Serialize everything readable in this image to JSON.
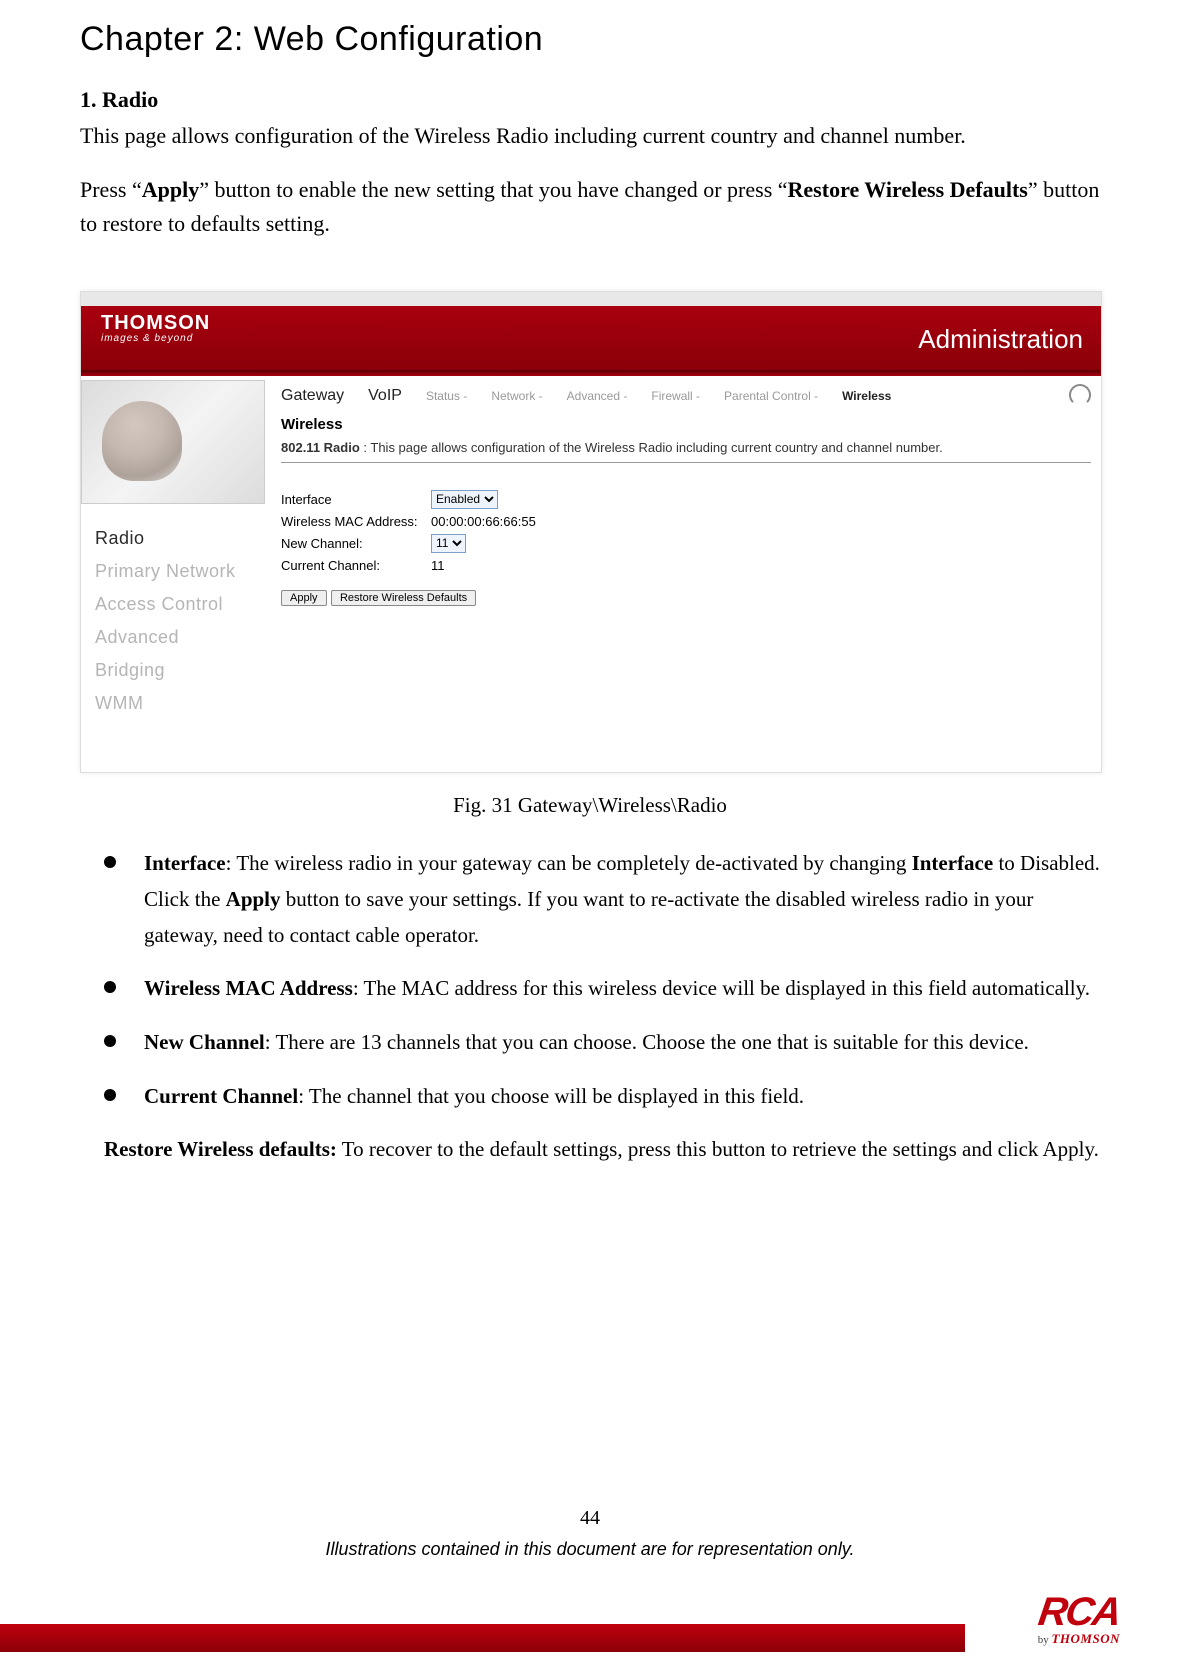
{
  "chapter_title": "Chapter 2: Web Configuration",
  "section": {
    "heading": "1. Radio",
    "intro": "This page allows configuration of the Wireless Radio including current country and channel number.",
    "press_prefix": "Press “",
    "apply_bold": "Apply",
    "press_mid": "” button to enable the new setting that you have changed or press “",
    "restore_bold": "Restore Wireless Defaults",
    "press_suffix": "” button to restore to defaults setting."
  },
  "screenshot": {
    "logo_big": "THOMSON",
    "logo_small": "images & beyond",
    "admin_title": "Administration",
    "tabs": {
      "gateway": "Gateway",
      "voip": "VoIP"
    },
    "subtabs": {
      "status": "Status -",
      "network": "Network -",
      "advanced": "Advanced -",
      "firewall": "Firewall -",
      "parental": "Parental Control -",
      "wireless": "Wireless"
    },
    "section_title": "Wireless",
    "desc_label": "802.11 Radio",
    "desc_sep": " : ",
    "desc_text": "This page allows configuration of the Wireless Radio including current country and channel number.",
    "sidenav": {
      "radio": "Radio",
      "primary": "Primary Network",
      "access": "Access Control",
      "advanced": "Advanced",
      "bridging": "Bridging",
      "wmm": "WMM"
    },
    "form": {
      "interface_label": "Interface",
      "interface_value": "Enabled",
      "mac_label": "Wireless MAC Address:",
      "mac_value": "00:00:00:66:66:55",
      "newch_label": "New Channel:",
      "newch_value": "11",
      "curch_label": "Current Channel:",
      "curch_value": "11"
    },
    "buttons": {
      "apply": "Apply",
      "restore": "Restore Wireless Defaults"
    }
  },
  "figure_caption": "Fig. 31 Gateway\\Wireless\\Radio",
  "bullets": {
    "b1_label": "Interface",
    "b1_text_a": ": The wireless radio in your gateway can be completely de-activated by changing ",
    "b1_bold_mid": "Interface",
    "b1_text_b": " to Disabled. Click the ",
    "b1_bold_apply": "Apply",
    "b1_text_c": " button to save your settings. If you want to re-activate the disabled wireless radio in your gateway, need to contact cable operator.",
    "b2_label": "Wireless MAC Address",
    "b2_text": ": The MAC address for this wireless device will be displayed in this field automatically.",
    "b3_label": "New Channel",
    "b3_text": ": There are 13 channels that you can choose. Choose the one that is suitable for this device.",
    "b4_label": "Current Channel",
    "b4_text": ": The channel that you choose will be displayed in this field."
  },
  "restore_para": {
    "label": "Restore Wireless defaults:",
    "text": " To recover to the default settings, press this button to retrieve the settings and click Apply."
  },
  "footer": {
    "page_number": "44",
    "disclaimer": "Illustrations contained in this document are for representation only.",
    "rca": "RCA",
    "by": "by ",
    "thomson": "THOMSON"
  }
}
